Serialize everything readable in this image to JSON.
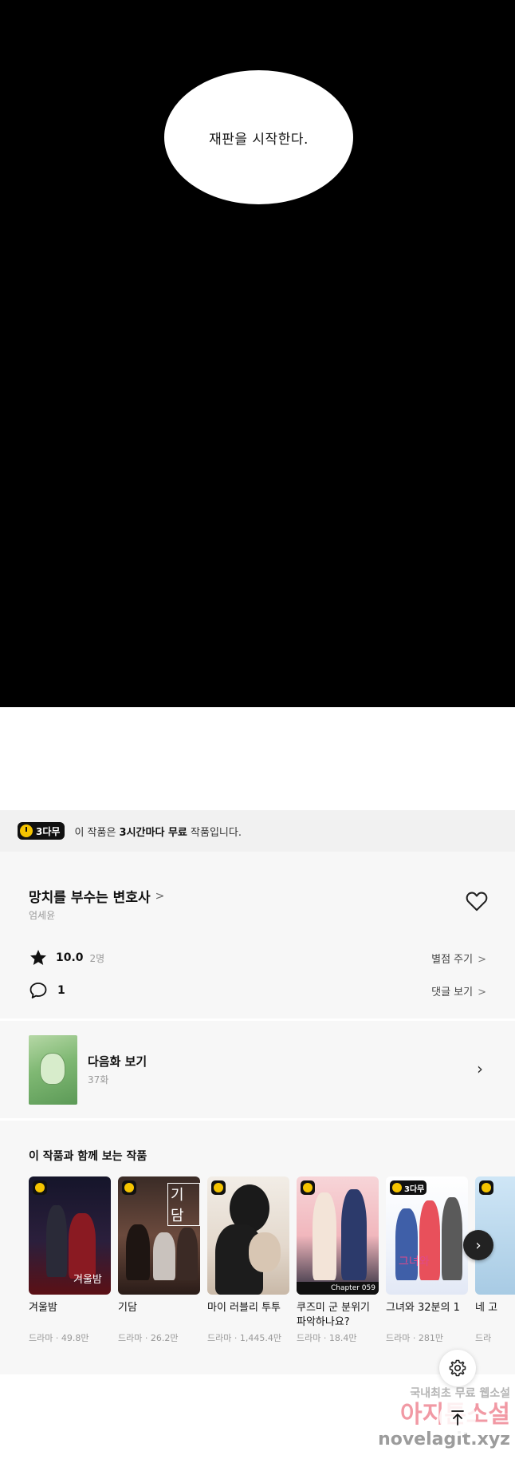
{
  "comic": {
    "bubble_text": "재판을 시작한다."
  },
  "free_banner": {
    "badge": "3다무",
    "text_prefix": "이 작품은 ",
    "text_bold": "3시간마다 무료",
    "text_suffix": " 작품입니다."
  },
  "work": {
    "title": "망치를 부수는 변호사",
    "title_chevron": ">",
    "author": "엄세윤",
    "rating": "10.0",
    "raters": "2명",
    "rate_link": "별점 주기",
    "comments": "1",
    "comments_link": "댓글 보기",
    "link_chevron": ">"
  },
  "next_episode": {
    "title": "다음화 보기",
    "episode": "37화",
    "chevron": "›"
  },
  "recommendations": {
    "title": "이 작품과 함께 보는 작품",
    "items": [
      {
        "title": "겨울밤",
        "meta": "드라마 · 49.8만",
        "badge": "",
        "cover_text": "겨울밤"
      },
      {
        "title": "기담",
        "meta": "드라마 · 26.2만",
        "badge": "",
        "cover_text": "기담"
      },
      {
        "title": "마이 러블리 투투",
        "meta": "드라마 · 1,445.4만",
        "badge": "",
        "cover_text": ""
      },
      {
        "title": "쿠즈미 군 분위기 파악하나요?",
        "meta": "드라마 · 18.4만",
        "badge": "",
        "cover_text": "Chapter 059"
      },
      {
        "title": "그녀와 32분의 1",
        "meta": "드라마 · 281만",
        "badge": "3다무",
        "cover_text": "그녀와"
      },
      {
        "title": "네 고",
        "meta": "드라",
        "badge": "",
        "cover_text": ""
      }
    ],
    "next_arrow": "›"
  },
  "watermark": {
    "line1": "국내최초 무료 웹소설",
    "line2": "아지툰소설",
    "line3": "novelagit.xyz"
  },
  "colors": {
    "badge_yellow": "#f5c400",
    "panel_bg": "#f7f7f7",
    "banner_bg": "#f1f1f1"
  },
  "icons": [
    "heart-icon",
    "star-icon",
    "comment-icon",
    "chevron-right-icon",
    "settings-icon",
    "scroll-top-icon",
    "clock-icon"
  ]
}
